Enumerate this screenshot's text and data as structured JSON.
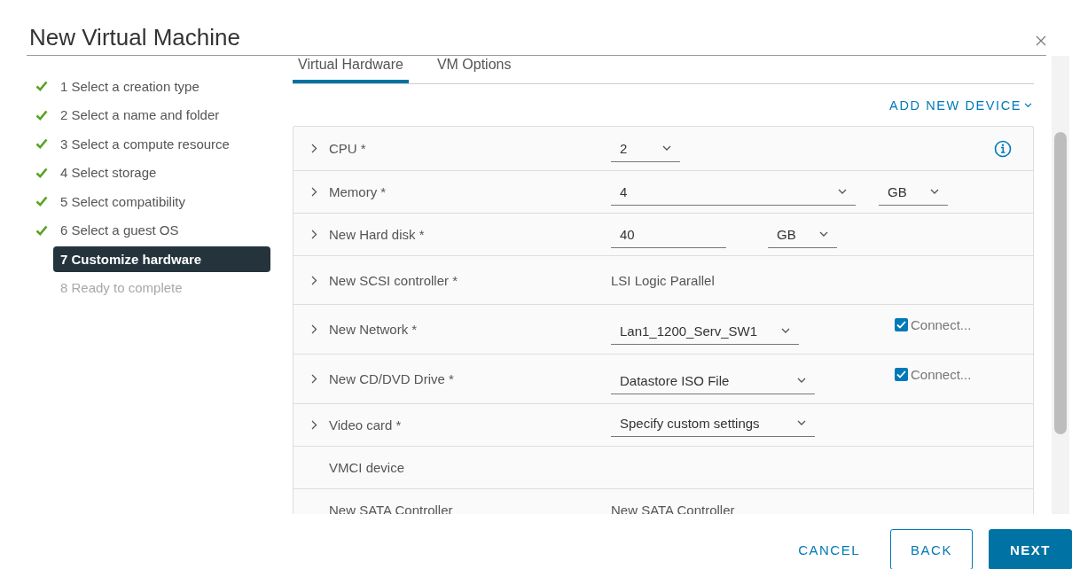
{
  "window": {
    "title": "New Virtual Machine"
  },
  "steps": [
    {
      "label": "1 Select a creation type",
      "kind": "done",
      "selected": false
    },
    {
      "label": "2 Select a name and folder",
      "kind": "done",
      "selected": false
    },
    {
      "label": "3 Select a compute resource",
      "kind": "done",
      "selected": false
    },
    {
      "label": "4 Select storage",
      "kind": "done",
      "selected": false
    },
    {
      "label": "5 Select compatibility",
      "kind": "done",
      "selected": false
    },
    {
      "label": "6 Select a guest OS",
      "kind": "done",
      "selected": false
    },
    {
      "label": "7 Customize hardware",
      "kind": "current",
      "selected": true
    },
    {
      "label": "8 Ready to complete",
      "kind": "pending",
      "selected": false
    }
  ],
  "tabs": [
    {
      "label": "Virtual Hardware",
      "selected": true
    },
    {
      "label": "VM Options",
      "selected": false
    }
  ],
  "add_device": {
    "label": "ADD NEW DEVICE"
  },
  "devices": [
    {
      "label": "CPU *",
      "expandable": true,
      "info": true,
      "controls": [
        {
          "kind": "select",
          "value": "2"
        }
      ]
    },
    {
      "label": "Memory *",
      "expandable": true,
      "controls": [
        {
          "kind": "select",
          "value": "4"
        },
        {
          "kind": "select",
          "value": "GB"
        }
      ]
    },
    {
      "label": "New Hard disk *",
      "expandable": true,
      "controls": [
        {
          "kind": "input",
          "value": "40"
        },
        {
          "kind": "select",
          "value": "GB"
        }
      ]
    },
    {
      "label": "New SCSI controller *",
      "expandable": true,
      "controls": [
        {
          "kind": "text",
          "value": "LSI Logic Parallel"
        }
      ]
    },
    {
      "label": "New Network *",
      "expandable": true,
      "controls": [
        {
          "kind": "select",
          "value": "Lan1_1200_Serv_SW1"
        }
      ],
      "connect": {
        "label": "Connect...",
        "checked": true
      }
    },
    {
      "label": "New CD/DVD Drive *",
      "expandable": true,
      "controls": [
        {
          "kind": "select",
          "value": "Datastore ISO File"
        }
      ],
      "connect": {
        "label": "Connect...",
        "checked": true
      }
    },
    {
      "label": "Video card *",
      "expandable": true,
      "controls": [
        {
          "kind": "select",
          "value": "Specify custom settings"
        }
      ]
    },
    {
      "label": "VMCI device",
      "expandable": false
    },
    {
      "label": "New SATA Controller",
      "expandable": false,
      "controls": [
        {
          "kind": "text",
          "value": "New SATA Controller"
        }
      ]
    }
  ],
  "buttons": [
    {
      "label": "CANCEL",
      "kind": "flat"
    },
    {
      "label": "BACK",
      "kind": "outline"
    },
    {
      "label": "NEXT",
      "kind": "primary"
    }
  ]
}
